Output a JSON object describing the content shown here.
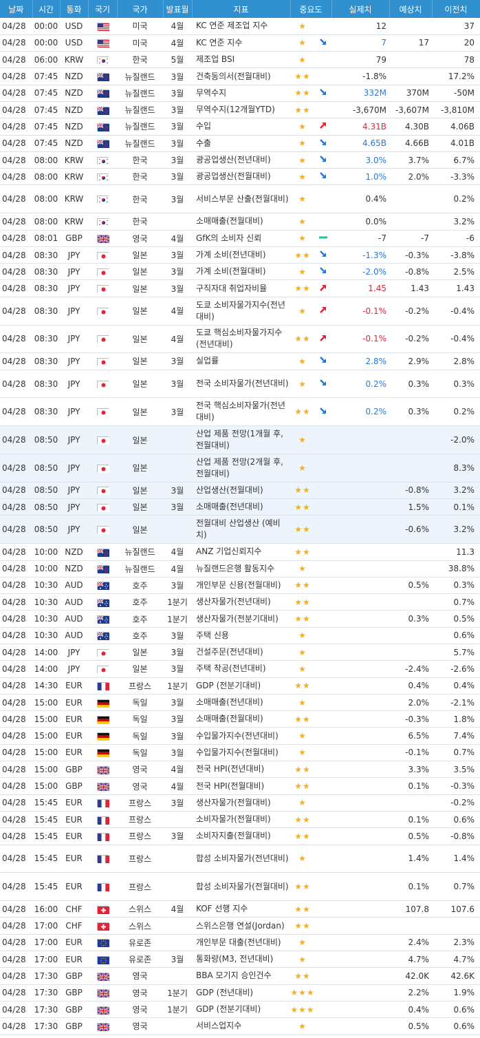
{
  "headers": [
    "날짜",
    "시간",
    "통화",
    "국기",
    "국가",
    "발표월",
    "지표",
    "중요도",
    "실제치",
    "예상치",
    "이전치"
  ],
  "rows": [
    {
      "date": "04/28",
      "time": "00:00",
      "cur": "USD",
      "flag": "us",
      "country": "미국",
      "period": "4월",
      "indicator": "KC 연준 제조업 지수",
      "stars": "★",
      "arrow": "",
      "actual": "12",
      "actual_color": "",
      "forecast": "",
      "previous": "37",
      "hl": false,
      "tall": false
    },
    {
      "date": "04/28",
      "time": "00:00",
      "cur": "USD",
      "flag": "us",
      "country": "미국",
      "period": "4월",
      "indicator": "KC 연준 지수",
      "stars": "★",
      "arrow": "down",
      "actual": "7",
      "actual_color": "down",
      "forecast": "17",
      "previous": "20",
      "hl": false,
      "tall": false
    },
    {
      "date": "04/28",
      "time": "06:00",
      "cur": "KRW",
      "flag": "kr",
      "country": "한국",
      "period": "5월",
      "indicator": "제조업 BSI",
      "stars": "★",
      "arrow": "",
      "actual": "79",
      "actual_color": "",
      "forecast": "",
      "previous": "78",
      "hl": false,
      "tall": false
    },
    {
      "date": "04/28",
      "time": "07:45",
      "cur": "NZD",
      "flag": "nz",
      "country": "뉴질랜드",
      "period": "3월",
      "indicator": "건축동의서(전월대비)",
      "stars": "★★",
      "arrow": "",
      "actual": "-1.8%",
      "actual_color": "",
      "forecast": "",
      "previous": "17.2%",
      "hl": false,
      "tall": false
    },
    {
      "date": "04/28",
      "time": "07:45",
      "cur": "NZD",
      "flag": "nz",
      "country": "뉴질랜드",
      "period": "3월",
      "indicator": "무역수지",
      "stars": "★★",
      "arrow": "down",
      "actual": "332M",
      "actual_color": "down",
      "forecast": "370M",
      "previous": "-50M",
      "hl": false,
      "tall": false
    },
    {
      "date": "04/28",
      "time": "07:45",
      "cur": "NZD",
      "flag": "nz",
      "country": "뉴질랜드",
      "period": "3월",
      "indicator": "무역수지(12개월YTD)",
      "stars": "★★",
      "arrow": "",
      "actual": "-3,670M",
      "actual_color": "",
      "forecast": "-3,607M",
      "previous": "-3,810M",
      "hl": false,
      "tall": false
    },
    {
      "date": "04/28",
      "time": "07:45",
      "cur": "NZD",
      "flag": "nz",
      "country": "뉴질랜드",
      "period": "3월",
      "indicator": "수입",
      "stars": "★",
      "arrow": "up",
      "actual": "4.31B",
      "actual_color": "up",
      "forecast": "4.30B",
      "previous": "4.06B",
      "hl": false,
      "tall": false
    },
    {
      "date": "04/28",
      "time": "07:45",
      "cur": "NZD",
      "flag": "nz",
      "country": "뉴질랜드",
      "period": "3월",
      "indicator": "수출",
      "stars": "★",
      "arrow": "down",
      "actual": "4.65B",
      "actual_color": "down",
      "forecast": "4.66B",
      "previous": "4.01B",
      "hl": false,
      "tall": false
    },
    {
      "date": "04/28",
      "time": "08:00",
      "cur": "KRW",
      "flag": "kr",
      "country": "한국",
      "period": "3월",
      "indicator": "광공업생산(전년대비)",
      "stars": "★",
      "arrow": "down",
      "actual": "3.0%",
      "actual_color": "down",
      "forecast": "3.7%",
      "previous": "6.7%",
      "hl": false,
      "tall": false
    },
    {
      "date": "04/28",
      "time": "08:00",
      "cur": "KRW",
      "flag": "kr",
      "country": "한국",
      "period": "3월",
      "indicator": "광공업생산(전월대비)",
      "stars": "★",
      "arrow": "down",
      "actual": "1.0%",
      "actual_color": "down",
      "forecast": "2.0%",
      "previous": "-3.3%",
      "hl": false,
      "tall": false
    },
    {
      "date": "04/28",
      "time": "08:00",
      "cur": "KRW",
      "flag": "kr",
      "country": "한국",
      "period": "3월",
      "indicator": "서비스부문 산출(전월대비)",
      "stars": "★",
      "arrow": "",
      "actual": "0.4%",
      "actual_color": "",
      "forecast": "",
      "previous": "0.2%",
      "hl": false,
      "tall": true
    },
    {
      "date": "04/28",
      "time": "08:00",
      "cur": "KRW",
      "flag": "kr",
      "country": "한국",
      "period": "",
      "indicator": "소매매출(전월대비)",
      "stars": "★",
      "arrow": "",
      "actual": "0.0%",
      "actual_color": "",
      "forecast": "",
      "previous": "3.2%",
      "hl": false,
      "tall": false
    },
    {
      "date": "04/28",
      "time": "08:01",
      "cur": "GBP",
      "flag": "gb",
      "country": "영국",
      "period": "4월",
      "indicator": "GfK의 소비자 신뢰",
      "stars": "★",
      "arrow": "eq",
      "actual": "-7",
      "actual_color": "",
      "forecast": "-7",
      "previous": "-6",
      "hl": false,
      "tall": false
    },
    {
      "date": "04/28",
      "time": "08:30",
      "cur": "JPY",
      "flag": "jp",
      "country": "일본",
      "period": "3월",
      "indicator": "가계 소비(전년대비)",
      "stars": "★★",
      "arrow": "down",
      "actual": "-1.3%",
      "actual_color": "down",
      "forecast": "-0.3%",
      "previous": "-3.8%",
      "hl": false,
      "tall": false
    },
    {
      "date": "04/28",
      "time": "08:30",
      "cur": "JPY",
      "flag": "jp",
      "country": "일본",
      "period": "3월",
      "indicator": "가계 소비(전월대비)",
      "stars": "★",
      "arrow": "down",
      "actual": "-2.0%",
      "actual_color": "down",
      "forecast": "-0.8%",
      "previous": "2.5%",
      "hl": false,
      "tall": false
    },
    {
      "date": "04/28",
      "time": "08:30",
      "cur": "JPY",
      "flag": "jp",
      "country": "일본",
      "period": "3월",
      "indicator": "구직자대 취업자비율",
      "stars": "★★",
      "arrow": "up",
      "actual": "1.45",
      "actual_color": "up",
      "forecast": "1.43",
      "previous": "1.43",
      "hl": false,
      "tall": false
    },
    {
      "date": "04/28",
      "time": "08:30",
      "cur": "JPY",
      "flag": "jp",
      "country": "일본",
      "period": "4월",
      "indicator": "도쿄 소비자물가지수(전년대비)",
      "stars": "★",
      "arrow": "up",
      "actual": "-0.1%",
      "actual_color": "up",
      "forecast": "-0.2%",
      "previous": "-0.4%",
      "hl": false,
      "tall": true
    },
    {
      "date": "04/28",
      "time": "08:30",
      "cur": "JPY",
      "flag": "jp",
      "country": "일본",
      "period": "4월",
      "indicator": "도쿄 핵심소비자물가지수(전년대비)",
      "stars": "★★",
      "arrow": "up",
      "actual": "-0.1%",
      "actual_color": "up",
      "forecast": "-0.2%",
      "previous": "-0.4%",
      "hl": false,
      "tall": true
    },
    {
      "date": "04/28",
      "time": "08:30",
      "cur": "JPY",
      "flag": "jp",
      "country": "일본",
      "period": "3월",
      "indicator": "실업률",
      "stars": "★",
      "arrow": "down",
      "actual": "2.8%",
      "actual_color": "down",
      "forecast": "2.9%",
      "previous": "2.8%",
      "hl": false,
      "tall": false
    },
    {
      "date": "04/28",
      "time": "08:30",
      "cur": "JPY",
      "flag": "jp",
      "country": "일본",
      "period": "3월",
      "indicator": "전국 소비자물가(전년대비)",
      "stars": "★",
      "arrow": "down",
      "actual": "0.2%",
      "actual_color": "down",
      "forecast": "0.3%",
      "previous": "0.3%",
      "hl": false,
      "tall": true
    },
    {
      "date": "04/28",
      "time": "08:30",
      "cur": "JPY",
      "flag": "jp",
      "country": "일본",
      "period": "3월",
      "indicator": "전국 핵심소비자물가(전년대비)",
      "stars": "★★",
      "arrow": "down",
      "actual": "0.2%",
      "actual_color": "down",
      "forecast": "0.3%",
      "previous": "0.2%",
      "hl": false,
      "tall": true
    },
    {
      "date": "04/28",
      "time": "08:50",
      "cur": "JPY",
      "flag": "jp",
      "country": "일본",
      "period": "",
      "indicator": "산업 제품 전망(1개월 후, 전월대비)",
      "stars": "★",
      "arrow": "",
      "actual": "",
      "actual_color": "",
      "forecast": "",
      "previous": "-2.0%",
      "hl": true,
      "tall": true
    },
    {
      "date": "04/28",
      "time": "08:50",
      "cur": "JPY",
      "flag": "jp",
      "country": "일본",
      "period": "",
      "indicator": "산업 제품 전망(2개월 후, 전월대비)",
      "stars": "★",
      "arrow": "",
      "actual": "",
      "actual_color": "",
      "forecast": "",
      "previous": "8.3%",
      "hl": true,
      "tall": true
    },
    {
      "date": "04/28",
      "time": "08:50",
      "cur": "JPY",
      "flag": "jp",
      "country": "일본",
      "period": "3월",
      "indicator": "산업생산(전월대비)",
      "stars": "★★",
      "arrow": "",
      "actual": "",
      "actual_color": "",
      "forecast": "-0.8%",
      "previous": "3.2%",
      "hl": true,
      "tall": false
    },
    {
      "date": "04/28",
      "time": "08:50",
      "cur": "JPY",
      "flag": "jp",
      "country": "일본",
      "period": "3월",
      "indicator": "소매매출(전년대비)",
      "stars": "★★",
      "arrow": "",
      "actual": "",
      "actual_color": "",
      "forecast": "1.5%",
      "previous": "0.1%",
      "hl": true,
      "tall": false
    },
    {
      "date": "04/28",
      "time": "08:50",
      "cur": "JPY",
      "flag": "jp",
      "country": "일본",
      "period": "",
      "indicator": "전월대비 산업생산 (예비치)",
      "stars": "★★",
      "arrow": "",
      "actual": "",
      "actual_color": "",
      "forecast": "-0.6%",
      "previous": "3.2%",
      "hl": true,
      "tall": true
    },
    {
      "date": "04/28",
      "time": "10:00",
      "cur": "NZD",
      "flag": "nz",
      "country": "뉴질랜드",
      "period": "4월",
      "indicator": "ANZ 기업신뢰지수",
      "stars": "★★",
      "arrow": "",
      "actual": "",
      "actual_color": "",
      "forecast": "",
      "previous": "11.3",
      "hl": false,
      "tall": false
    },
    {
      "date": "04/28",
      "time": "10:00",
      "cur": "NZD",
      "flag": "nz",
      "country": "뉴질랜드",
      "period": "4월",
      "indicator": "뉴질랜드은행 활동지수",
      "stars": "★",
      "arrow": "",
      "actual": "",
      "actual_color": "",
      "forecast": "",
      "previous": "38.8%",
      "hl": false,
      "tall": false
    },
    {
      "date": "04/28",
      "time": "10:30",
      "cur": "AUD",
      "flag": "au",
      "country": "호주",
      "period": "3월",
      "indicator": "개인부문 신용(전월대비)",
      "stars": "★★",
      "arrow": "",
      "actual": "",
      "actual_color": "",
      "forecast": "0.5%",
      "previous": "0.3%",
      "hl": false,
      "tall": false
    },
    {
      "date": "04/28",
      "time": "10:30",
      "cur": "AUD",
      "flag": "au",
      "country": "호주",
      "period": "1분기",
      "indicator": "생산자물가(전년대비)",
      "stars": "★★",
      "arrow": "",
      "actual": "",
      "actual_color": "",
      "forecast": "",
      "previous": "0.7%",
      "hl": false,
      "tall": false
    },
    {
      "date": "04/28",
      "time": "10:30",
      "cur": "AUD",
      "flag": "au",
      "country": "호주",
      "period": "1분기",
      "indicator": "생산자물가(전분기대비)",
      "stars": "★★",
      "arrow": "",
      "actual": "",
      "actual_color": "",
      "forecast": "0.3%",
      "previous": "0.5%",
      "hl": false,
      "tall": false
    },
    {
      "date": "04/28",
      "time": "10:30",
      "cur": "AUD",
      "flag": "au",
      "country": "호주",
      "period": "3월",
      "indicator": "주택 신용",
      "stars": "★",
      "arrow": "",
      "actual": "",
      "actual_color": "",
      "forecast": "",
      "previous": "0.6%",
      "hl": false,
      "tall": false
    },
    {
      "date": "04/28",
      "time": "14:00",
      "cur": "JPY",
      "flag": "jp",
      "country": "일본",
      "period": "3월",
      "indicator": "건설주문(전년대비)",
      "stars": "★",
      "arrow": "",
      "actual": "",
      "actual_color": "",
      "forecast": "",
      "previous": "5.7%",
      "hl": false,
      "tall": false
    },
    {
      "date": "04/28",
      "time": "14:00",
      "cur": "JPY",
      "flag": "jp",
      "country": "일본",
      "period": "3월",
      "indicator": "주택 착공(전년대비)",
      "stars": "★",
      "arrow": "",
      "actual": "",
      "actual_color": "",
      "forecast": "-2.4%",
      "previous": "-2.6%",
      "hl": false,
      "tall": false
    },
    {
      "date": "04/28",
      "time": "14:30",
      "cur": "EUR",
      "flag": "fr",
      "country": "프랑스",
      "period": "1분기",
      "indicator": "GDP (전분기대비)",
      "stars": "★★",
      "arrow": "",
      "actual": "",
      "actual_color": "",
      "forecast": "0.4%",
      "previous": "0.4%",
      "hl": false,
      "tall": false
    },
    {
      "date": "04/28",
      "time": "15:00",
      "cur": "EUR",
      "flag": "de",
      "country": "독일",
      "period": "3월",
      "indicator": "소매매출(전년대비)",
      "stars": "★",
      "arrow": "",
      "actual": "",
      "actual_color": "",
      "forecast": "2.0%",
      "previous": "-2.1%",
      "hl": false,
      "tall": false
    },
    {
      "date": "04/28",
      "time": "15:00",
      "cur": "EUR",
      "flag": "de",
      "country": "독일",
      "period": "3월",
      "indicator": "소매매출(전월대비)",
      "stars": "★★",
      "arrow": "",
      "actual": "",
      "actual_color": "",
      "forecast": "-0.3%",
      "previous": "1.8%",
      "hl": false,
      "tall": false
    },
    {
      "date": "04/28",
      "time": "15:00",
      "cur": "EUR",
      "flag": "de",
      "country": "독일",
      "period": "3월",
      "indicator": "수입물가지수(전년대비)",
      "stars": "★",
      "arrow": "",
      "actual": "",
      "actual_color": "",
      "forecast": "6.5%",
      "previous": "7.4%",
      "hl": false,
      "tall": false
    },
    {
      "date": "04/28",
      "time": "15:00",
      "cur": "EUR",
      "flag": "de",
      "country": "독일",
      "period": "3월",
      "indicator": "수입물가지수(전월대비)",
      "stars": "★",
      "arrow": "",
      "actual": "",
      "actual_color": "",
      "forecast": "-0.1%",
      "previous": "0.7%",
      "hl": false,
      "tall": false
    },
    {
      "date": "04/28",
      "time": "15:00",
      "cur": "GBP",
      "flag": "gb",
      "country": "영국",
      "period": "4월",
      "indicator": "전국 HPI(전년대비)",
      "stars": "★★",
      "arrow": "",
      "actual": "",
      "actual_color": "",
      "forecast": "3.3%",
      "previous": "3.5%",
      "hl": false,
      "tall": false
    },
    {
      "date": "04/28",
      "time": "15:00",
      "cur": "GBP",
      "flag": "gb",
      "country": "영국",
      "period": "4월",
      "indicator": "전국 HPI(전월대비)",
      "stars": "★★",
      "arrow": "",
      "actual": "",
      "actual_color": "",
      "forecast": "0.1%",
      "previous": "-0.3%",
      "hl": false,
      "tall": false
    },
    {
      "date": "04/28",
      "time": "15:45",
      "cur": "EUR",
      "flag": "fr",
      "country": "프랑스",
      "period": "3월",
      "indicator": "생산자물가(전월대비)",
      "stars": "★",
      "arrow": "",
      "actual": "",
      "actual_color": "",
      "forecast": "",
      "previous": "-0.2%",
      "hl": false,
      "tall": false
    },
    {
      "date": "04/28",
      "time": "15:45",
      "cur": "EUR",
      "flag": "fr",
      "country": "프랑스",
      "period": "",
      "indicator": "소비자물가(전월대비)",
      "stars": "★★",
      "arrow": "",
      "actual": "",
      "actual_color": "",
      "forecast": "0.1%",
      "previous": "0.6%",
      "hl": false,
      "tall": false
    },
    {
      "date": "04/28",
      "time": "15:45",
      "cur": "EUR",
      "flag": "fr",
      "country": "프랑스",
      "period": "3월",
      "indicator": "소비자지출(전월대비)",
      "stars": "★★",
      "arrow": "",
      "actual": "",
      "actual_color": "",
      "forecast": "0.5%",
      "previous": "-0.8%",
      "hl": false,
      "tall": false
    },
    {
      "date": "04/28",
      "time": "15:45",
      "cur": "EUR",
      "flag": "fr",
      "country": "프랑스",
      "period": "",
      "indicator": "합성 소비자물가(전년대비)",
      "stars": "★",
      "arrow": "",
      "actual": "",
      "actual_color": "",
      "forecast": "1.4%",
      "previous": "1.4%",
      "hl": false,
      "tall": true
    },
    {
      "date": "04/28",
      "time": "15:45",
      "cur": "EUR",
      "flag": "fr",
      "country": "프랑스",
      "period": "",
      "indicator": "합성 소비자물가(전월대비)",
      "stars": "★★",
      "arrow": "",
      "actual": "",
      "actual_color": "",
      "forecast": "0.1%",
      "previous": "0.7%",
      "hl": false,
      "tall": true
    },
    {
      "date": "04/28",
      "time": "16:00",
      "cur": "CHF",
      "flag": "ch",
      "country": "스위스",
      "period": "4월",
      "indicator": "KOF 선행 지수",
      "stars": "★★",
      "arrow": "",
      "actual": "",
      "actual_color": "",
      "forecast": "107.8",
      "previous": "107.6",
      "hl": false,
      "tall": false
    },
    {
      "date": "04/28",
      "time": "17:00",
      "cur": "CHF",
      "flag": "ch",
      "country": "스위스",
      "period": "",
      "indicator": "스위스은행 연설(Jordan)",
      "stars": "★★",
      "arrow": "",
      "actual": "",
      "actual_color": "",
      "forecast": "",
      "previous": "",
      "hl": false,
      "tall": false
    },
    {
      "date": "04/28",
      "time": "17:00",
      "cur": "EUR",
      "flag": "eu",
      "country": "유로존",
      "period": "",
      "indicator": "개인부문 대출(전년대비)",
      "stars": "★",
      "arrow": "",
      "actual": "",
      "actual_color": "",
      "forecast": "2.4%",
      "previous": "2.3%",
      "hl": false,
      "tall": false
    },
    {
      "date": "04/28",
      "time": "17:00",
      "cur": "EUR",
      "flag": "eu",
      "country": "유로존",
      "period": "3월",
      "indicator": "통화량(M3, 전년대비)",
      "stars": "★",
      "arrow": "",
      "actual": "",
      "actual_color": "",
      "forecast": "4.7%",
      "previous": "4.7%",
      "hl": false,
      "tall": false
    },
    {
      "date": "04/28",
      "time": "17:30",
      "cur": "GBP",
      "flag": "gb",
      "country": "영국",
      "period": "",
      "indicator": "BBA 모기지 승인건수",
      "stars": "★★",
      "arrow": "",
      "actual": "",
      "actual_color": "",
      "forecast": "42.0K",
      "previous": "42.6K",
      "hl": false,
      "tall": false
    },
    {
      "date": "04/28",
      "time": "17:30",
      "cur": "GBP",
      "flag": "gb",
      "country": "영국",
      "period": "1분기",
      "indicator": "GDP (전년대비)",
      "stars": "★★★",
      "arrow": "",
      "actual": "",
      "actual_color": "",
      "forecast": "2.2%",
      "previous": "1.9%",
      "hl": false,
      "tall": false
    },
    {
      "date": "04/28",
      "time": "17:30",
      "cur": "GBP",
      "flag": "gb",
      "country": "영국",
      "period": "1분기",
      "indicator": "GDP (전분기대비)",
      "stars": "★★★",
      "arrow": "",
      "actual": "",
      "actual_color": "",
      "forecast": "0.4%",
      "previous": "0.6%",
      "hl": false,
      "tall": false
    },
    {
      "date": "04/28",
      "time": "17:30",
      "cur": "GBP",
      "flag": "gb",
      "country": "영국",
      "period": "",
      "indicator": "서비스업지수",
      "stars": "★",
      "arrow": "",
      "actual": "",
      "actual_color": "",
      "forecast": "0.5%",
      "previous": "0.6%",
      "hl": false,
      "tall": false
    }
  ],
  "colors": {
    "header_bg": "#2f8fcf",
    "up": "#e0243a",
    "down": "#2878d8",
    "star": "#f2b01e",
    "highlight_row": "#eef4fb",
    "neutral": "#1bc29a"
  }
}
